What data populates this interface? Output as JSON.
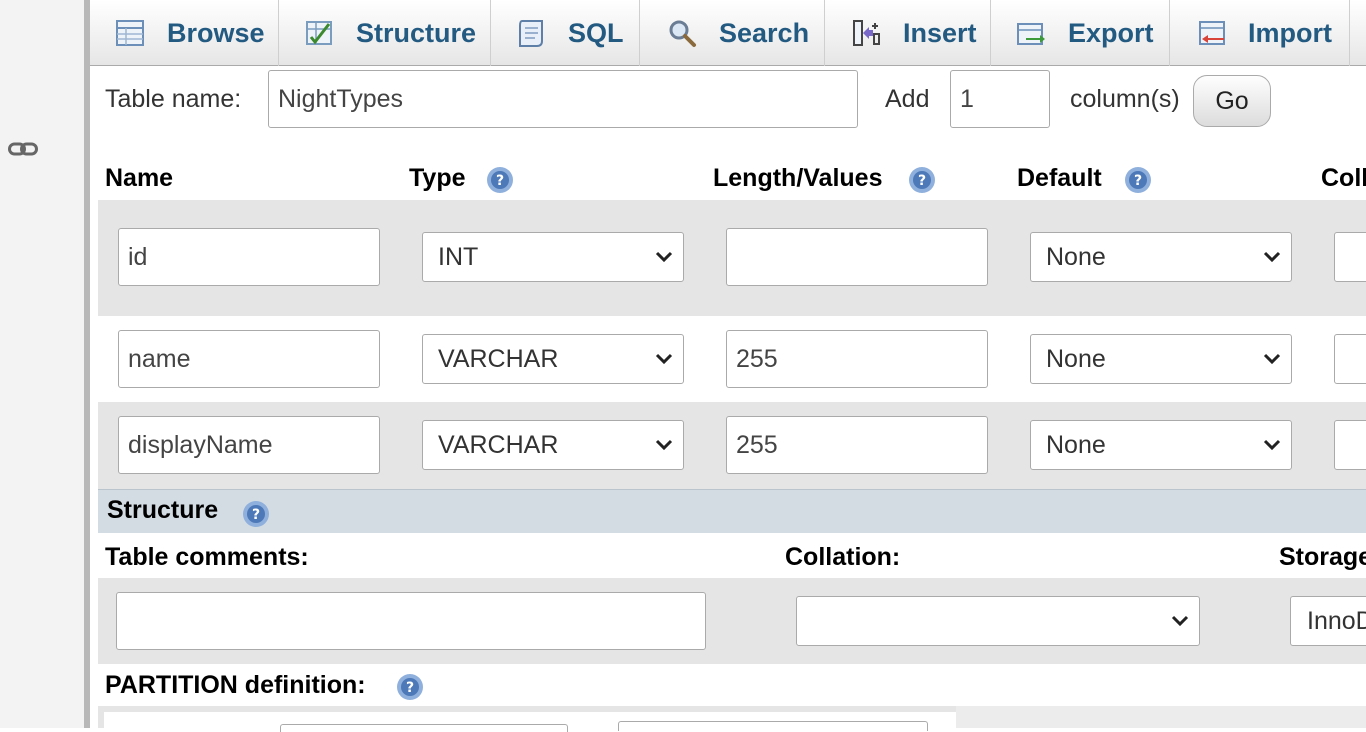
{
  "tabs": [
    {
      "label": "Browse",
      "icon": "browse-icon"
    },
    {
      "label": "Structure",
      "icon": "structure-icon"
    },
    {
      "label": "SQL",
      "icon": "sql-icon"
    },
    {
      "label": "Search",
      "icon": "search-icon"
    },
    {
      "label": "Insert",
      "icon": "insert-icon"
    },
    {
      "label": "Export",
      "icon": "export-icon"
    },
    {
      "label": "Import",
      "icon": "import-icon"
    }
  ],
  "table_form": {
    "table_name_label": "Table name:",
    "table_name_value": "NightTypes",
    "add_label": "Add",
    "add_count": "1",
    "columns_label": "column(s)",
    "go_label": "Go"
  },
  "column_headers": {
    "name": "Name",
    "type": "Type",
    "length": "Length/Values",
    "default": "Default",
    "collation": "Coll"
  },
  "columns": [
    {
      "name": "id",
      "type": "INT",
      "length": "",
      "default": "None"
    },
    {
      "name": "name",
      "type": "VARCHAR",
      "length": "255",
      "default": "None"
    },
    {
      "name": "displayName",
      "type": "VARCHAR",
      "length": "255",
      "default": "None"
    }
  ],
  "structure": {
    "title": "Structure",
    "table_comments_label": "Table comments:",
    "table_comments_value": "",
    "collation_label": "Collation:",
    "collation_value": "",
    "storage_label": "Storage",
    "storage_value": "InnoD",
    "partition_label": "PARTITION definition:"
  },
  "colors": {
    "tab_text": "#235a81",
    "row_alt": "#e5e5e5",
    "section_bar": "#d3dce3",
    "help_icon": "#5b8ac6"
  }
}
